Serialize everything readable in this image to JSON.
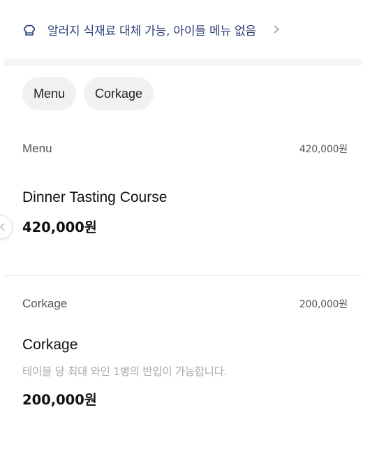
{
  "notice": {
    "icon": "chef-hat-icon",
    "text": "알러지 식재료 대체 가능, 아이들 메뉴 없음",
    "chevron": "chevron-right-icon"
  },
  "tabs": [
    {
      "label": "Menu"
    },
    {
      "label": "Corkage"
    }
  ],
  "sections": [
    {
      "title": "Menu",
      "total": "420,000원",
      "items": [
        {
          "name": "Dinner Tasting Course",
          "description": "",
          "price": "420,000원"
        }
      ]
    },
    {
      "title": "Corkage",
      "total": "200,000원",
      "items": [
        {
          "name": "Corkage",
          "description": "테이블 당 최대 와인 1병의 반입이 가능합니다.",
          "price": "200,000원"
        }
      ]
    }
  ],
  "prev_button": {
    "icon": "chevron-left-icon"
  },
  "colors": {
    "notice_text": "#2d3f77",
    "chip_bg": "#f1f1f1",
    "muted": "#aaaaaa"
  }
}
